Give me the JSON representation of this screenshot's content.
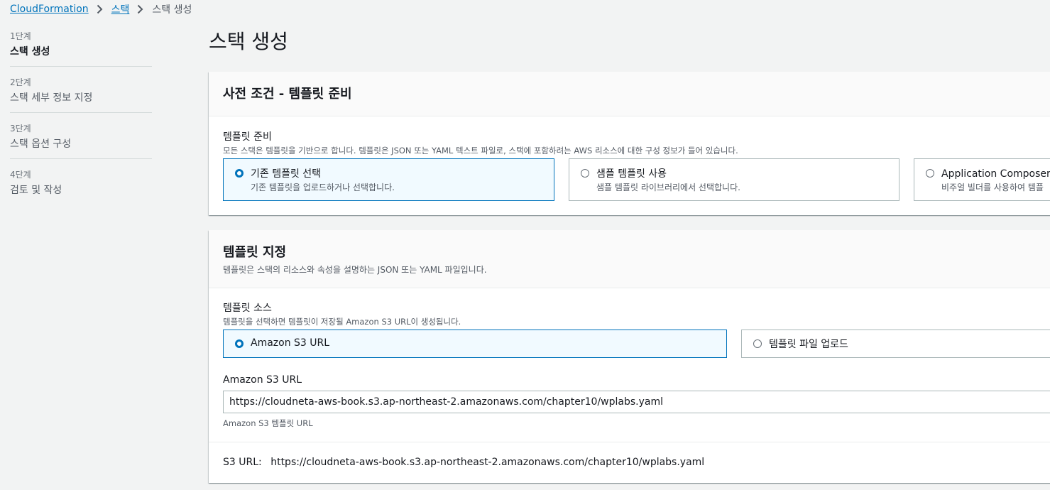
{
  "breadcrumb": {
    "items": [
      "CloudFormation",
      "스택"
    ],
    "current": "스택 생성"
  },
  "steps": [
    {
      "num": "1단계",
      "title": "스택 생성"
    },
    {
      "num": "2단계",
      "title": "스택 세부 정보 지정"
    },
    {
      "num": "3단계",
      "title": "스택 옵션 구성"
    },
    {
      "num": "4단계",
      "title": "검토 및 작성"
    }
  ],
  "page_title": "스택 생성",
  "prereq": {
    "title": "사전 조건 - 템플릿 준비",
    "field_label": "템플릿 준비",
    "field_desc": "모든 스택은 템플릿을 기반으로 합니다. 템플릿은 JSON 또는 YAML 텍스트 파일로, 스택에 포함하려는 AWS 리소스에 대한 구성 정보가 들어 있습니다.",
    "options": [
      {
        "title": "기존 템플릿 선택",
        "desc": "기존 템플릿을 업로드하거나 선택합니다.",
        "selected": true
      },
      {
        "title": "샘플 템플릿 사용",
        "desc": "샘플 템플릿 라이브러리에서 선택합니다.",
        "selected": false
      },
      {
        "title": "Application Composer에",
        "desc": "비주얼 빌더를 사용하여 템플",
        "selected": false
      }
    ]
  },
  "specify": {
    "title": "템플릿 지정",
    "desc": "템플릿은 스택의 리소스와 속성을 설명하는 JSON 또는 YAML 파일입니다.",
    "source_label": "템플릿 소스",
    "source_desc": "템플릿을 선택하면 템플릿이 저장될 Amazon S3 URL이 생성됩니다.",
    "sources": [
      {
        "title": "Amazon S3 URL",
        "selected": true
      },
      {
        "title": "템플릿 파일 업로드",
        "selected": false
      }
    ],
    "url_label": "Amazon S3 URL",
    "url_value": "https://cloudneta-aws-book.s3.ap-northeast-2.amazonaws.com/chapter10/wplabs.yaml",
    "url_hint": "Amazon S3 템플릿 URL",
    "s3_url_label": "S3 URL:",
    "s3_url_value": "https://cloudneta-aws-book.s3.ap-northeast-2.amazonaws.com/chapter10/wplabs.yaml"
  },
  "colors": {
    "link": "#0073bb",
    "selected_border": "#0073bb",
    "selected_bg": "#f1faff",
    "page_bg": "#f2f3f3"
  }
}
